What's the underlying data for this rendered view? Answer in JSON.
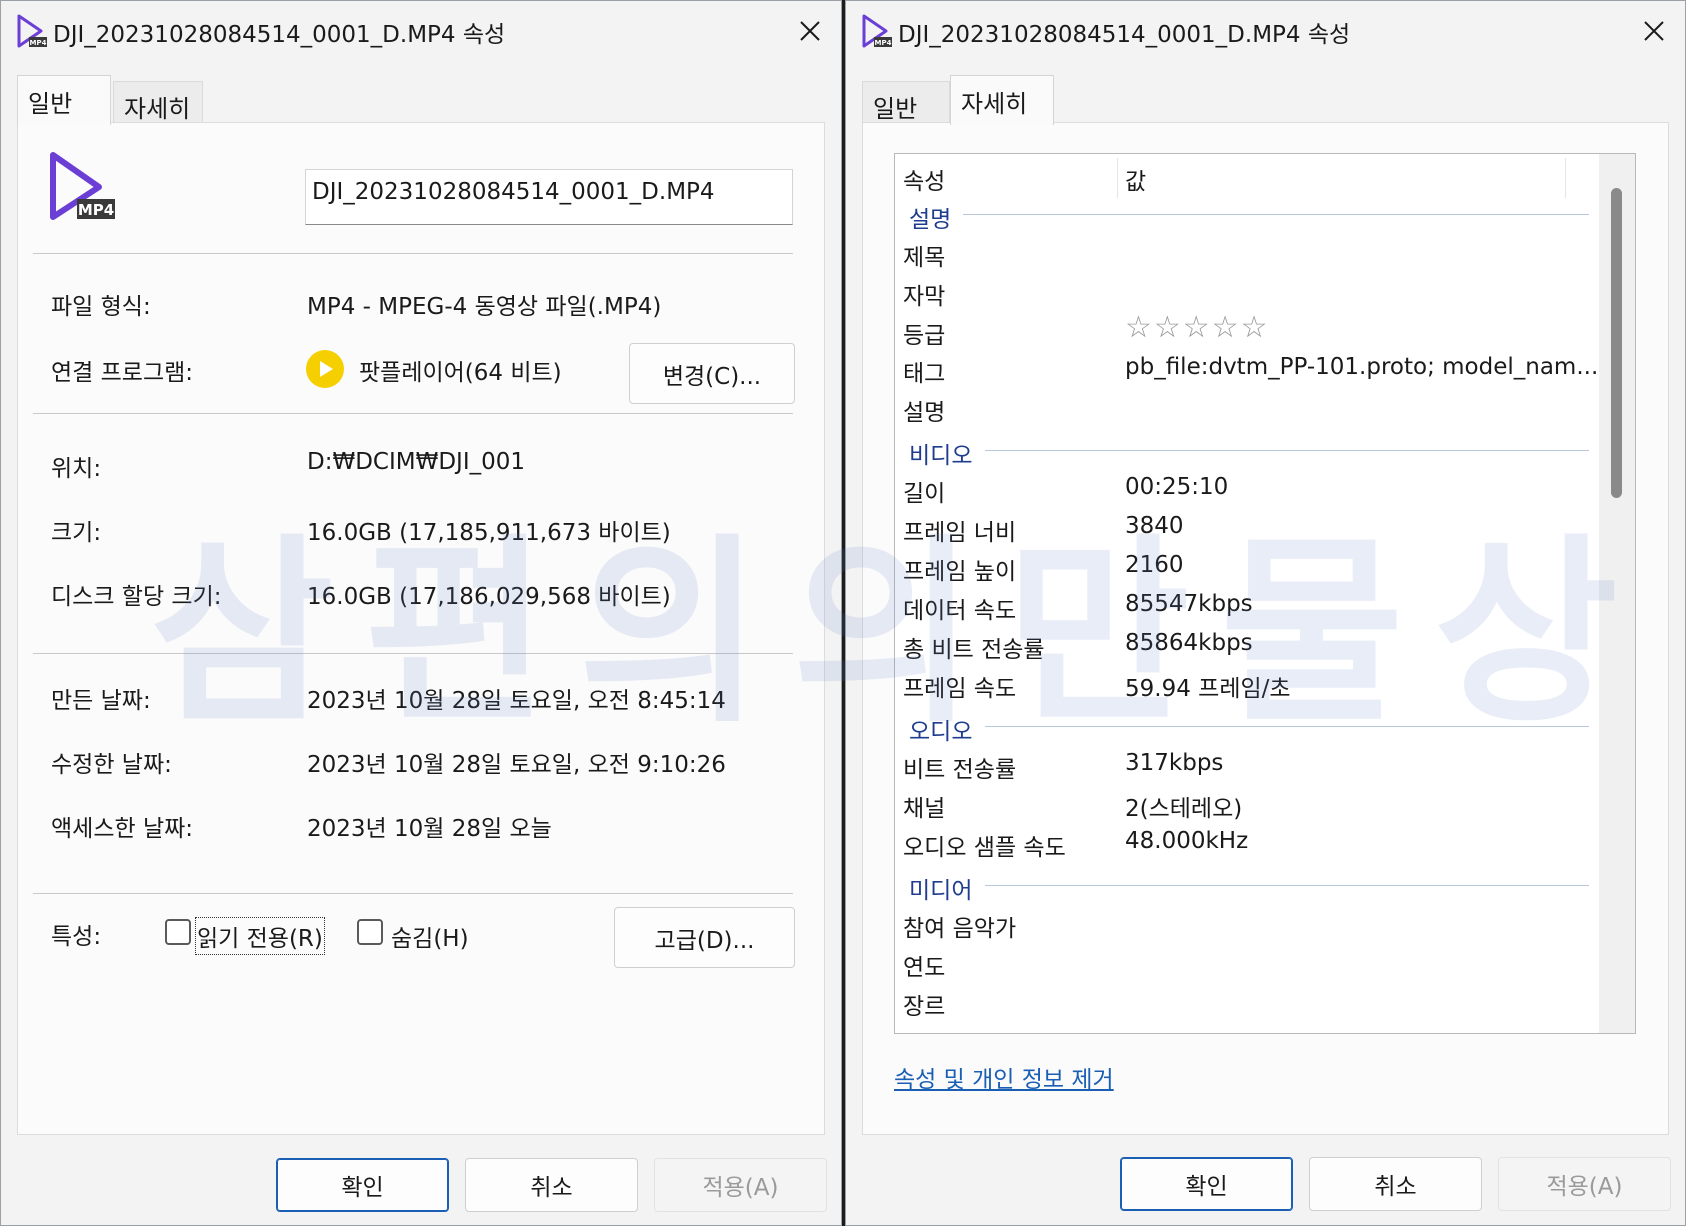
{
  "left_window": {
    "title": "DJI_20231028084514_0001_D.MP4 속성",
    "tabs": [
      "일반",
      "자세히"
    ],
    "file_icon_badge": "MP4",
    "file_name": "DJI_20231028084514_0001_D.MP4",
    "fields": {
      "type_label": "파일 형식:",
      "type_value": "MP4 - MPEG-4 동영상 파일(.MP4)",
      "program_label": "연결 프로그램:",
      "program_value": "팟플레이어(64 비트)",
      "change_button": "변경(C)...",
      "location_label": "위치:",
      "location_value": "D:₩DCIM₩DJI_001",
      "size_label": "크기:",
      "size_value": "16.0GB (17,185,911,673 바이트)",
      "disk_label": "디스크 할당 크기:",
      "disk_value": "16.0GB (17,186,029,568 바이트)",
      "created_label": "만든 날짜:",
      "created_value": "2023년 10월 28일 토요일, 오전 8:45:14",
      "modified_label": "수정한 날짜:",
      "modified_value": "2023년 10월 28일 토요일, 오전 9:10:26",
      "accessed_label": "액세스한 날짜:",
      "accessed_value": "2023년 10월 28일 오늘",
      "attributes_label": "특성:",
      "readonly_label": "읽기 전용(R)",
      "hidden_label": "숨김(H)",
      "advanced_button": "고급(D)..."
    },
    "buttons": {
      "ok": "확인",
      "cancel": "취소",
      "apply": "적용(A)"
    }
  },
  "right_window": {
    "title": "DJI_20231028084514_0001_D.MP4 속성",
    "tabs": [
      "일반",
      "자세히"
    ],
    "columns": {
      "property": "속성",
      "value": "값"
    },
    "groups": {
      "description": "설명",
      "video": "비디오",
      "audio": "오디오",
      "media": "미디어"
    },
    "rows": {
      "title_p": "제목",
      "subtitle_p": "자막",
      "rating_p": "등급",
      "rating_v": "☆☆☆☆☆",
      "tags_p": "태그",
      "tags_v": "pb_file:dvtm_PP-101.proto; model_nam...",
      "comment_p": "설명",
      "length_p": "길이",
      "length_v": "00:25:10",
      "width_p": "프레임 너비",
      "width_v": "3840",
      "height_p": "프레임 높이",
      "height_v": "2160",
      "datarate_p": "데이터 속도",
      "datarate_v": "85547kbps",
      "totalbit_p": "총 비트 전송률",
      "totalbit_v": "85864kbps",
      "framerate_p": "프레임 속도",
      "framerate_v": "59.94 프레임/초",
      "abitrate_p": "비트 전송률",
      "abitrate_v": "317kbps",
      "channels_p": "채널",
      "channels_v": "2(스테레오)",
      "samplerate_p": "오디오 샘플 속도",
      "samplerate_v": "48.000kHz",
      "artist_p": "참여 음악가",
      "year_p": "연도",
      "genre_p": "장르"
    },
    "remove_link": "속성 및 개인 정보 제거",
    "buttons": {
      "ok": "확인",
      "cancel": "취소",
      "apply": "적용(A)"
    }
  },
  "watermark": "삼편의의만물상",
  "colors": {
    "accent": "#1a5fb4",
    "group_text": "#1f3d8f",
    "mp4_icon": "#6b3fd6",
    "potplayer": "#f5cf00"
  }
}
